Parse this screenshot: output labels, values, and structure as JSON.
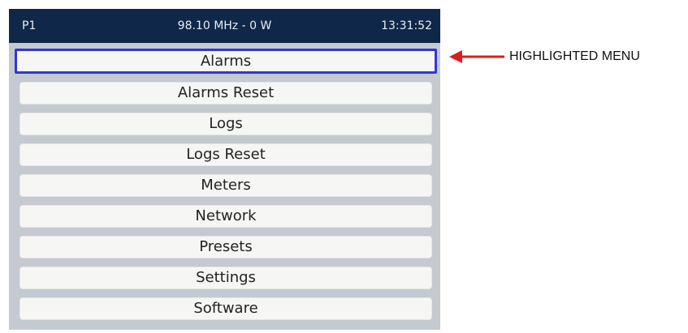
{
  "statusbar": {
    "preset": "P1",
    "frequency_power": "98.10 MHz - 0 W",
    "time": "13:31:52"
  },
  "menu": {
    "items": [
      {
        "label": "Alarms",
        "highlighted": true
      },
      {
        "label": "Alarms Reset"
      },
      {
        "label": "Logs"
      },
      {
        "label": "Logs Reset"
      },
      {
        "label": "Meters"
      },
      {
        "label": "Network"
      },
      {
        "label": "Presets"
      },
      {
        "label": "Settings"
      },
      {
        "label": "Software"
      }
    ]
  },
  "annotation": {
    "label": "HIGHLIGHTED MENU",
    "arrow_color": "#e01b1b"
  },
  "colors": {
    "statusbar_bg": "#0f2748",
    "screen_bg": "#c5c9d0",
    "highlight_border": "#2e36d8"
  }
}
